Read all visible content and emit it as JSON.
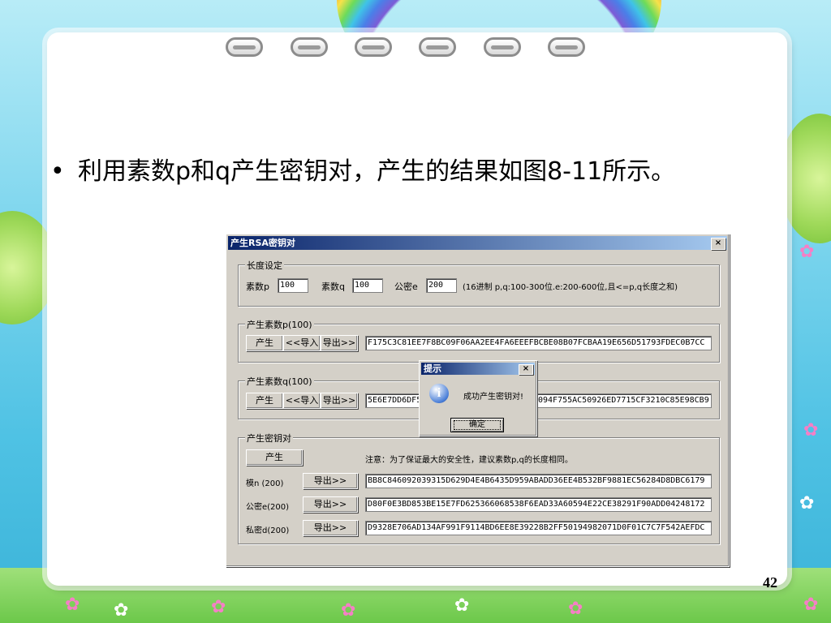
{
  "slide": {
    "bullet": "•",
    "text": "利用素数p和q产生密钥对，产生的结果如图8-11所示。",
    "page_number": "42"
  },
  "dialog": {
    "title": "产生RSA密钥对",
    "close": "×",
    "length_group": {
      "legend": "长度设定",
      "p_label": "素数p",
      "p_value": "100",
      "q_label": "素数q",
      "q_value": "100",
      "e_label": "公密e",
      "e_value": "200",
      "hint": "(16进制 p,q:100-300位.e:200-600位,且<=p,q长度之和)"
    },
    "p_group": {
      "legend": "产生素数p(100)",
      "gen": "产生",
      "import": "<<导入",
      "export": "导出>>",
      "value": "F175C3C81EE7F8BC09F06AA2EE4FA6EEEFBCBE08B07FCBAA19E656D51793FDEC0B7CC"
    },
    "q_group": {
      "legend": "产生素数q(100)",
      "gen": "产生",
      "import": "<<导入",
      "export": "导出>>",
      "value_left": "5E6E7DD6DF5",
      "value_right": "094F755AC50926ED7715CF3210C85E98CB9"
    },
    "key_group": {
      "legend": "产生密钥对",
      "gen": "产生",
      "note": "注意：为了保证最大的安全性，建议素数p,q的长度相同。",
      "n_label": "模n (200)",
      "n_export": "导出>>",
      "n_value": "BB8C846092039315D629D4E4B6435D959ABADD36EE4B532BF9881EC56284D8DBC6179",
      "e_label": "公密e(200)",
      "e_export": "导出>>",
      "e_value": "D80F0E3BD853BE15E7FD625366068538F6EAD33A60594E22CE38291F90ADD04248172",
      "d_label": "私密d(200)",
      "d_export": "导出>>",
      "d_value": "D9328E706AD134AF991F9114BD6EE8E39228B2FF50194982071D0F01C7C7F542AEFDC"
    }
  },
  "msgbox": {
    "title": "提示",
    "close": "×",
    "icon": "i",
    "text": "成功产生密钥对!",
    "ok": "确定"
  }
}
